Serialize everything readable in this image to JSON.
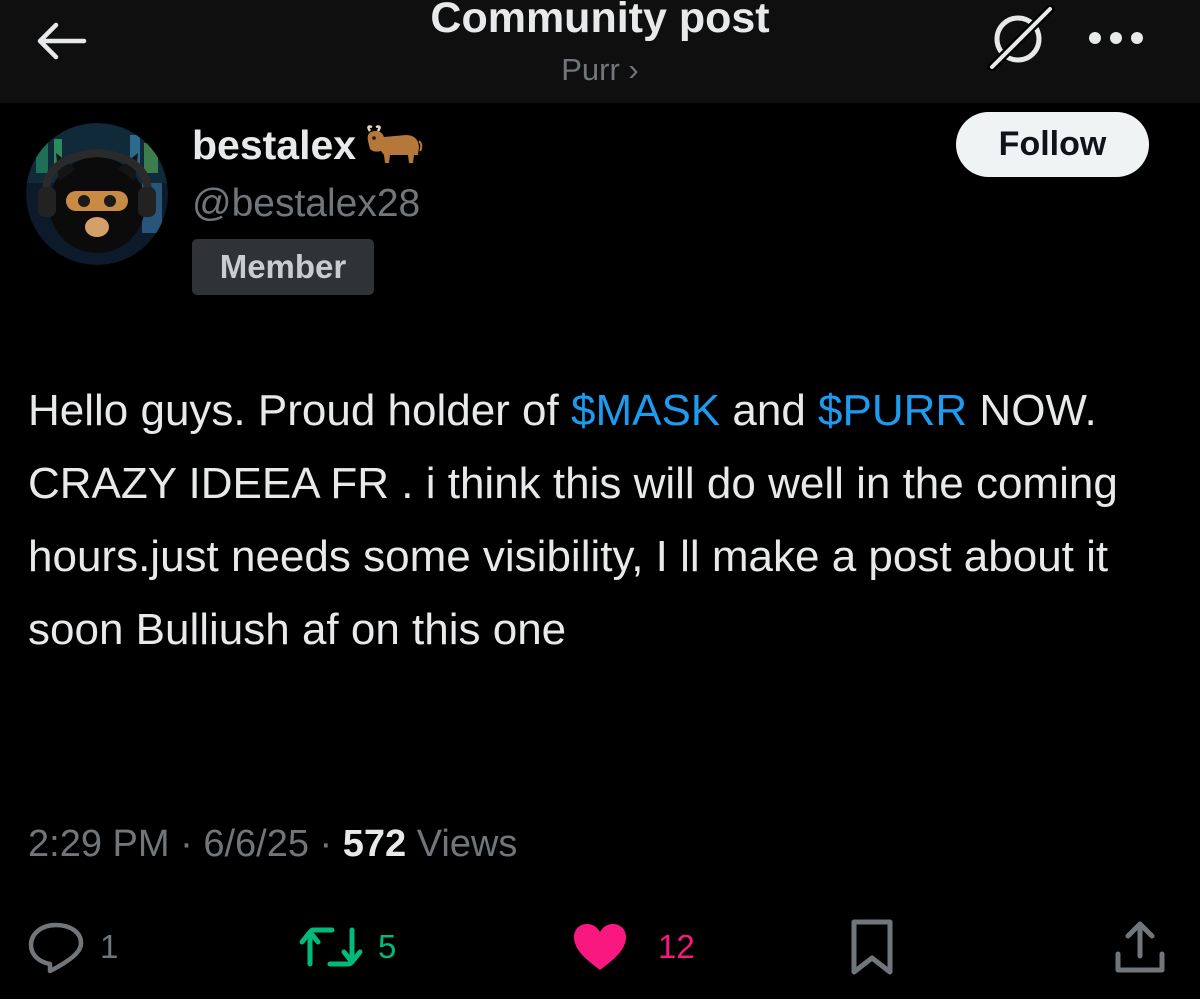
{
  "header": {
    "title": "Community post",
    "community_link": "Purr ›",
    "icons": {
      "back": "arrow-left-icon",
      "grok": "grok-icon",
      "more": "more-horizontal-icon"
    }
  },
  "author": {
    "display_name": "bestalex",
    "name_emoji": "ox-emoji-icon",
    "handle": "@bestalex28",
    "role_badge": "Member",
    "avatar": "masked-cat-avatar",
    "follow_label": "Follow"
  },
  "post": {
    "segments": {
      "s1": "Hello guys. Proud holder of ",
      "tag1": "$MASK",
      "s2": " and ",
      "tag2": "$PURR",
      "s3": " NOW. CRAZY IDEEA FR . i think this will do well in the coming hours.just needs some visibility, I ll make a post about it soon Bulliush af on this one"
    },
    "time": "2:29 PM",
    "date": "6/6/25",
    "separator": "·",
    "views_count": "572",
    "views_label": "Views"
  },
  "actions": {
    "replies": "1",
    "reposts": "5",
    "likes": "12",
    "icons": {
      "reply": "reply-icon",
      "repost": "repost-icon",
      "like": "heart-icon",
      "bookmark": "bookmark-icon",
      "share": "share-icon"
    }
  },
  "colors": {
    "background": "#000000",
    "accent_link": "#1d9bf0",
    "repost": "#00ba7c",
    "like": "#f91880",
    "muted": "#71767b"
  }
}
